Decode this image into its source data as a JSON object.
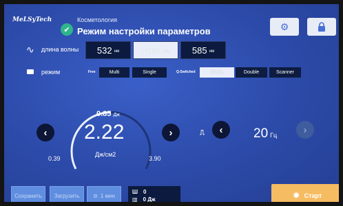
{
  "brand": "MeLSyTech",
  "header": {
    "breadcrumb": "Косметология",
    "title": "Режим настройки параметров"
  },
  "icons": {
    "check": "check-icon",
    "settings": "gear-icon",
    "lock": "lock-icon",
    "wave": "wave-icon",
    "mode": "mode-icon",
    "pulse": "pulse-icon",
    "counter": "counter-icon",
    "start": "sun-icon"
  },
  "wavelength": {
    "label": "длина волны",
    "options": [
      {
        "value": "532",
        "unit": "нм",
        "selected": false
      },
      {
        "value": "1064",
        "unit": "нм",
        "selected": true
      },
      {
        "value": "585",
        "unit": "нм",
        "selected": false
      }
    ]
  },
  "mode": {
    "label": "режим",
    "free_label": "Free",
    "free_options": [
      "Multi",
      "Single"
    ],
    "qswitch_label": "Q-Switched",
    "qswitch_options": [
      "Single",
      "Double",
      "Scanner"
    ],
    "qswitch_selected": "Single"
  },
  "fluence": {
    "spot": "0.85",
    "spot_unit": "Дж",
    "value": "2.22",
    "unit": "Дж/см2",
    "min": "0.39",
    "max": "3.90",
    "level": 0.5
  },
  "frequency": {
    "value": "20",
    "unit": "Гц"
  },
  "bottom": {
    "save": "Сохранить",
    "load": "Загрузить",
    "timer": "1 мин",
    "counter_top": "0",
    "counter_bottom": "0 Дж",
    "start": "Старт"
  },
  "colors": {
    "accent": "#2fb58c",
    "start": "#f6bc62",
    "background": "#2f4fb0"
  }
}
